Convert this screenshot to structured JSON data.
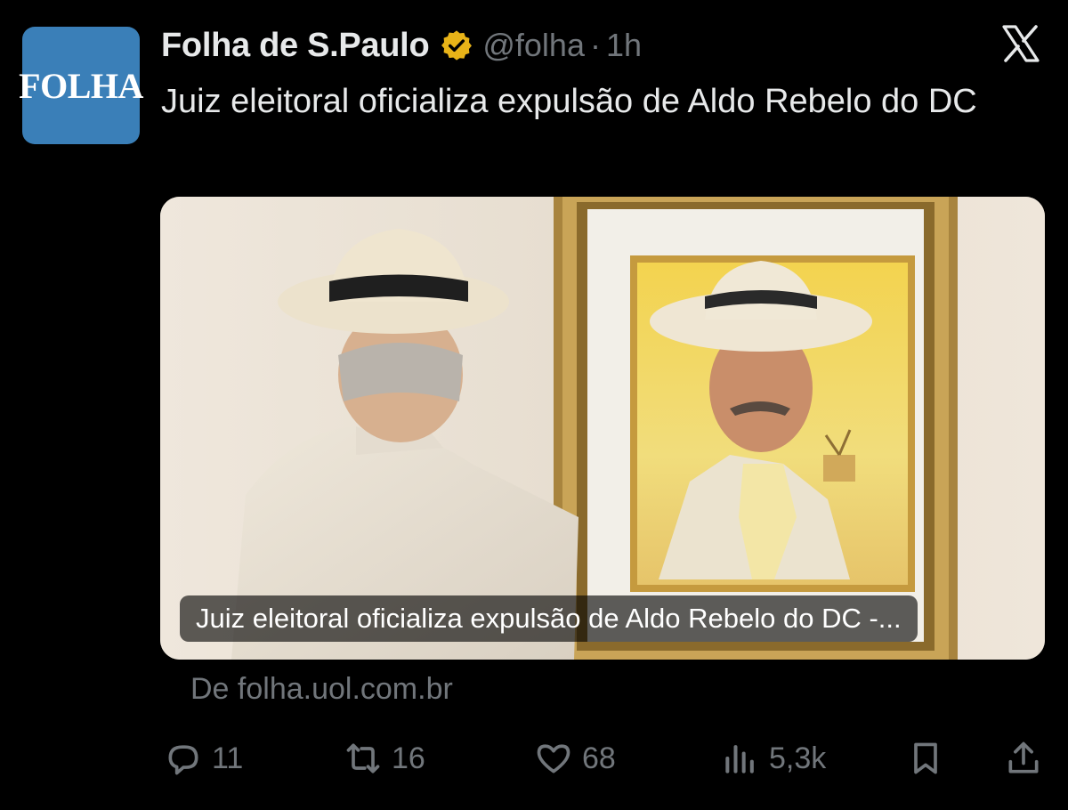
{
  "author": {
    "avatar_text": "FOLHA",
    "name": "Folha de S.Paulo",
    "handle": "@folha",
    "separator": "·",
    "time": "1h",
    "verified_badge_color": "#e8b318"
  },
  "tweet": {
    "text": "Juiz eleitoral oficializa expulsão de Aldo Rebelo do DC"
  },
  "card": {
    "caption": "Juiz eleitoral oficializa expulsão de Aldo Rebelo do DC -...",
    "source": "De folha.uol.com.br"
  },
  "actions": {
    "replies": "11",
    "reposts": "16",
    "likes": "68",
    "views": "5,3k"
  },
  "icons": [
    "verified-badge-icon",
    "x-logo-icon",
    "reply-icon",
    "repost-icon",
    "like-icon",
    "views-icon",
    "bookmark-icon",
    "share-icon"
  ],
  "colors": {
    "background": "#000000",
    "text": "#e7e9ea",
    "muted": "#71767b",
    "avatar_bg": "#3a7fb8"
  }
}
